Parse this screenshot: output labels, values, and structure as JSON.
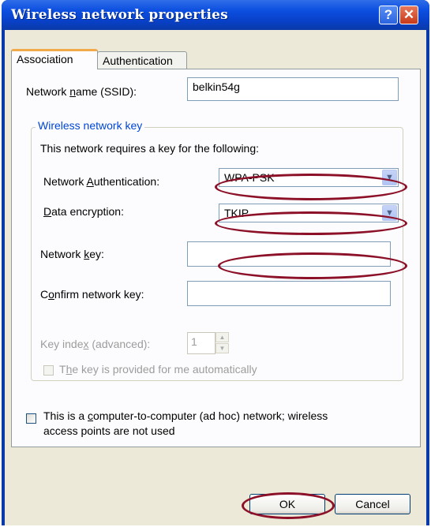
{
  "window": {
    "title": "Wireless network properties",
    "help_glyph": "?",
    "close_glyph": "✕"
  },
  "tabs": [
    {
      "label": "Association",
      "active": true
    },
    {
      "label": "Authentication",
      "active": false
    }
  ],
  "ssid": {
    "label_pre": "Network ",
    "label_key": "n",
    "label_post": "ame (SSID):",
    "value": "belkin54g"
  },
  "key_group": {
    "title": "Wireless network key",
    "intro": "This network requires a key for the following:",
    "auth": {
      "label_pre": "Network ",
      "label_key": "A",
      "label_post": "uthentication:",
      "value": "WPA-PSK"
    },
    "encryption": {
      "label_pre": "",
      "label_key": "D",
      "label_post": "ata encryption:",
      "value": "TKIP"
    },
    "network_key": {
      "label_pre": "Network ",
      "label_key": "k",
      "label_post": "ey:",
      "value": ""
    },
    "confirm_key": {
      "label_pre": "C",
      "label_key": "o",
      "label_post": "nfirm network key:",
      "value": ""
    },
    "key_index": {
      "label_pre": "Key inde",
      "label_key": "x",
      "label_post": " (advanced):",
      "value": "1"
    },
    "auto_key": {
      "label_pre": "T",
      "label_key": "h",
      "label_post": "e key is provided for me automatically",
      "checked": false,
      "enabled": false
    }
  },
  "adhoc": {
    "line1_pre": "This is a ",
    "line1_key": "c",
    "line1_post": "omputer-to-computer (ad hoc) network; wireless",
    "line2": "access points are not used",
    "checked": false
  },
  "buttons": {
    "ok": "OK",
    "cancel": "Cancel"
  },
  "annotation_color": "#8c1028",
  "accent_color": "#0a3aa8"
}
